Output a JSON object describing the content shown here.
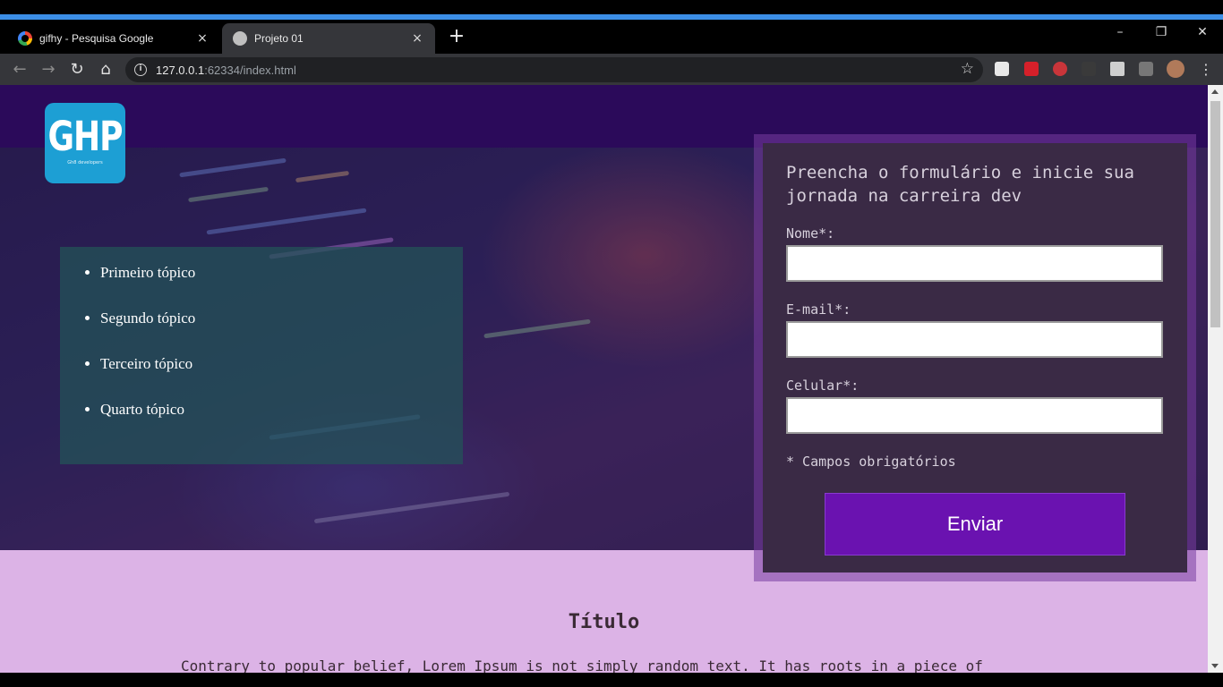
{
  "browser": {
    "tabs": [
      {
        "title": "gifhy - Pesquisa Google",
        "close": "×"
      },
      {
        "title": "Projeto 01",
        "close": "×"
      }
    ],
    "new_tab": "+",
    "window_controls": {
      "minimize": "–",
      "restore": "❐",
      "close": "✕"
    },
    "nav": {
      "back": "←",
      "forward": "→",
      "reload": "↻",
      "home": "⌂"
    },
    "address": {
      "host": "127.0.0.1",
      "rest": ":62334/index.html"
    },
    "bookmark_star": "☆"
  },
  "page": {
    "logo": {
      "mark": "GHP",
      "sub": "Gh8 developers"
    },
    "topics": [
      "Primeiro tópico",
      "Segundo tópico",
      "Terceiro tópico",
      "Quarto tópico"
    ],
    "form": {
      "heading": "Preencha o formulário e inicie sua jornada na carreira dev",
      "name_label": "Nome*:",
      "email_label": "E-mail*:",
      "phone_label": "Celular*:",
      "required_note": "* Campos obrigatórios",
      "submit_label": "Enviar"
    },
    "section": {
      "title": "Título",
      "text": "Contrary to popular belief, Lorem Ipsum is not simply random text. It has roots in a piece of"
    }
  },
  "colors": {
    "header": "#2b0a5a",
    "logo_bg": "#1d9fd4",
    "button": "#6a12b0",
    "content_bg": "#dcb3e6",
    "tab_accent": "#3c8ee6"
  }
}
